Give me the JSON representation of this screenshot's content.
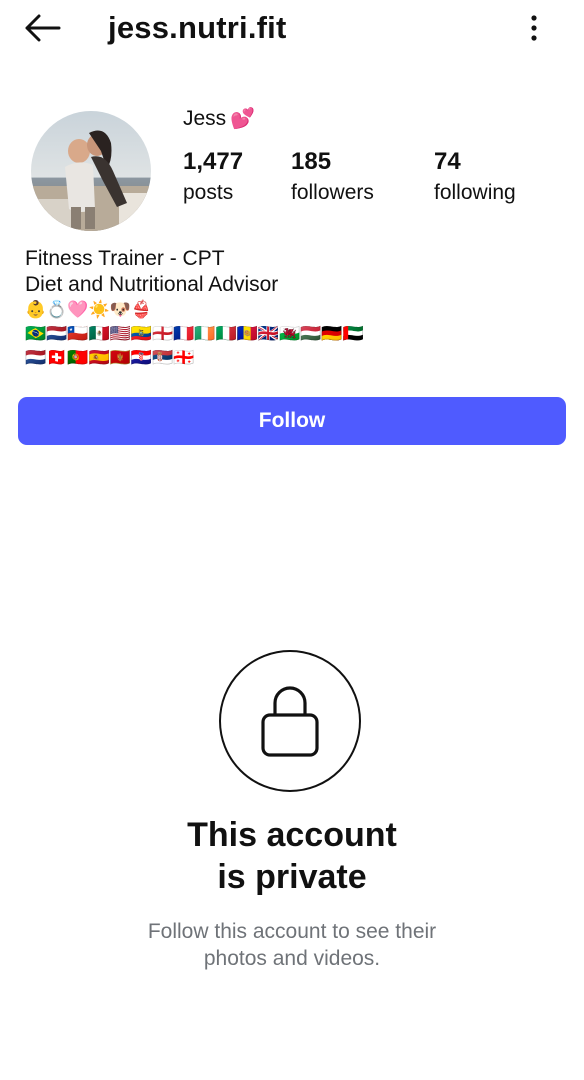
{
  "header": {
    "username": "jess.nutri.fit",
    "back_icon": "arrow-left-icon",
    "more_icon": "more-vertical-icon"
  },
  "profile": {
    "display_name": "Jess",
    "name_emoji": "💕",
    "stats": {
      "posts": {
        "value": "1,477",
        "label": "posts"
      },
      "followers": {
        "value": "185",
        "label": "followers"
      },
      "following": {
        "value": "74",
        "label": "following"
      }
    }
  },
  "bio": {
    "line1": "Fitness Trainer - CPT",
    "line2": "Diet and Nutritional Advisor",
    "emoji_line1": "👶💍🩷☀️🐶👙",
    "emoji_line2": "🇧🇷🇳🇱🇨🇱🇲🇽🇺🇸🇪🇨🏴󠁧󠁢󠁥󠁮󠁧󠁿🇫🇷🇮🇪🇮🇹🇦🇩🇬🇧🏴󠁧󠁢󠁷󠁬󠁳󠁿🇭🇺🇩🇪🇦🇪",
    "emoji_line3": "🇳🇱🇨🇭🇵🇹🇪🇸🇲🇪🇭🇷🇷🇸🇬🇪"
  },
  "actions": {
    "follow_label": "Follow"
  },
  "private_notice": {
    "lock_icon": "lock-icon",
    "title_line1": "This account",
    "title_line2": "is private",
    "subtitle_line1": "Follow this account to see their",
    "subtitle_line2": "photos and videos."
  },
  "colors": {
    "accent": "#4f5bff",
    "text": "#111111",
    "muted": "#6f7378",
    "background": "#ffffff"
  }
}
